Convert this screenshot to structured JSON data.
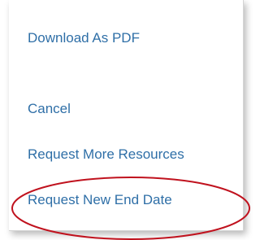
{
  "menu": {
    "items": [
      {
        "label": "Download As PDF"
      },
      {
        "label": "Cancel"
      },
      {
        "label": "Request More Resources"
      },
      {
        "label": "Request New End Date"
      }
    ]
  },
  "colors": {
    "link": "#2f6fa7",
    "highlight_ellipse": "#c0121e"
  }
}
